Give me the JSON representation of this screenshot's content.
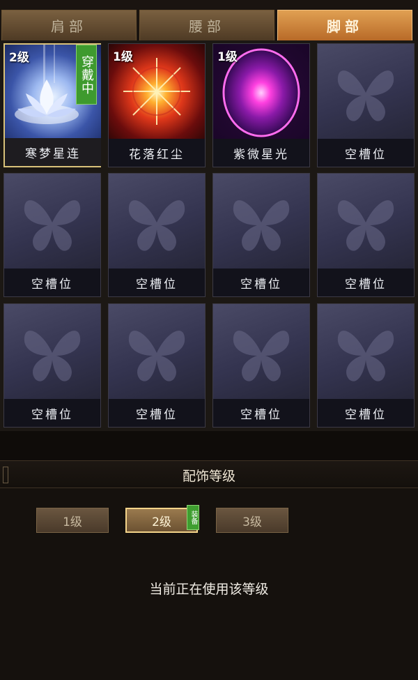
{
  "tabs": [
    {
      "label": "肩部",
      "active": false
    },
    {
      "label": "腰部",
      "active": false
    },
    {
      "label": "脚部",
      "active": true
    }
  ],
  "slots": [
    {
      "name": "寒梦星连",
      "level": "2级",
      "wear": "穿戴中",
      "icon": "lotus-icon"
    },
    {
      "name": "花落红尘",
      "level": "1级",
      "icon": "red-burst-icon"
    },
    {
      "name": "紫微星光",
      "level": "1级",
      "icon": "purple-orb-icon"
    },
    {
      "name": "空槽位",
      "icon": "butterfly-icon"
    },
    {
      "name": "空槽位",
      "icon": "butterfly-icon"
    },
    {
      "name": "空槽位",
      "icon": "butterfly-icon"
    },
    {
      "name": "空槽位",
      "icon": "butterfly-icon"
    },
    {
      "name": "空槽位",
      "icon": "butterfly-icon"
    },
    {
      "name": "空槽位",
      "icon": "butterfly-icon"
    },
    {
      "name": "空槽位",
      "icon": "butterfly-icon"
    },
    {
      "name": "空槽位",
      "icon": "butterfly-icon"
    },
    {
      "name": "空槽位",
      "icon": "butterfly-icon"
    }
  ],
  "section": {
    "title": "配饰等级"
  },
  "levels": [
    {
      "label": "1级",
      "active": false
    },
    {
      "label": "2级",
      "active": true
    },
    {
      "label": "3级",
      "active": false
    }
  ],
  "equip_badge": "装备",
  "status_text": "当前正在使用该等级",
  "colors": {
    "accent": "#d9c27a",
    "tab_active": "#e0a052",
    "wear_green": "#3e9a2e"
  }
}
